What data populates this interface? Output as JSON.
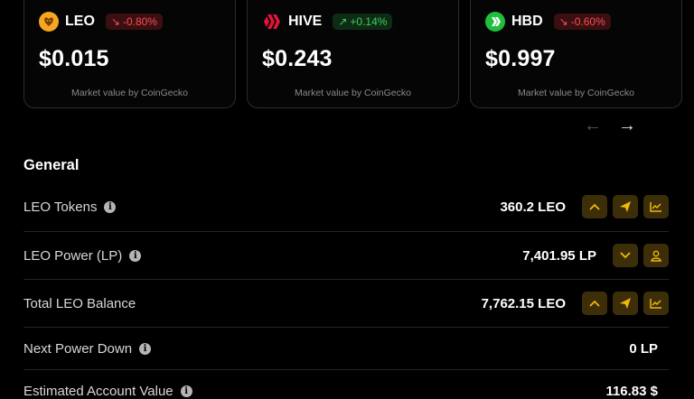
{
  "cards": [
    {
      "symbol": "LEO",
      "change": "-0.80%",
      "direction": "down",
      "price": "$0.015",
      "source": "Market value by CoinGecko",
      "icon": "leo-lion-icon",
      "color": "#f5a623"
    },
    {
      "symbol": "HIVE",
      "change": "+0.14%",
      "direction": "up",
      "price": "$0.243",
      "source": "Market value by CoinGecko",
      "icon": "hive-logo-icon",
      "color": "#e31337"
    },
    {
      "symbol": "HBD",
      "change": "-0.60%",
      "direction": "down",
      "price": "$0.997",
      "source": "Market value by CoinGecko",
      "icon": "hbd-logo-icon",
      "color": "#1fbf3c"
    }
  ],
  "carousel": {
    "prev": "←",
    "next": "→"
  },
  "general": {
    "title": "General",
    "rows": [
      {
        "label": "LEO Tokens",
        "value": "360.2 LEO",
        "actions": [
          "chevron-up-icon",
          "send-icon",
          "chart-icon"
        ]
      },
      {
        "label": "LEO Power (LP)",
        "value": "7,401.95 LP",
        "actions": [
          "chevron-down-icon",
          "user-icon"
        ]
      },
      {
        "label": "Total LEO Balance",
        "value": "7,762.15 LEO",
        "actions": [
          "chevron-up-icon",
          "send-icon",
          "chart-icon"
        ]
      },
      {
        "label": "Next Power Down",
        "value": "0 LP",
        "actions": []
      },
      {
        "label": "Estimated Account Value",
        "value": "116.83 $",
        "actions": []
      }
    ]
  },
  "colors": {
    "accent": "#f0b90b",
    "action_bg": "#3d2e0a",
    "down": "#ff4d4f",
    "up": "#3ccf5d"
  }
}
